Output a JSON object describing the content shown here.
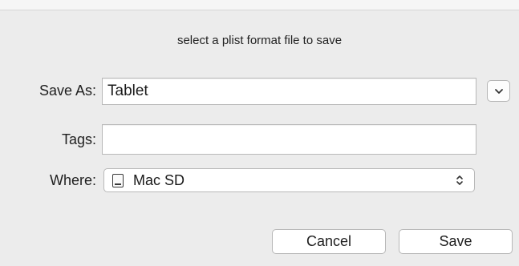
{
  "dialog": {
    "message": "select a plist format file to save"
  },
  "save_as": {
    "label": "Save As:",
    "value": "Tablet"
  },
  "tags": {
    "label": "Tags:",
    "value": ""
  },
  "where": {
    "label": "Where:",
    "value": "Mac SD"
  },
  "buttons": {
    "cancel": "Cancel",
    "save": "Save"
  },
  "icons": {
    "expand": "chevron-down-icon",
    "disk": "disk-icon",
    "popup": "updown-chevron-icon"
  }
}
